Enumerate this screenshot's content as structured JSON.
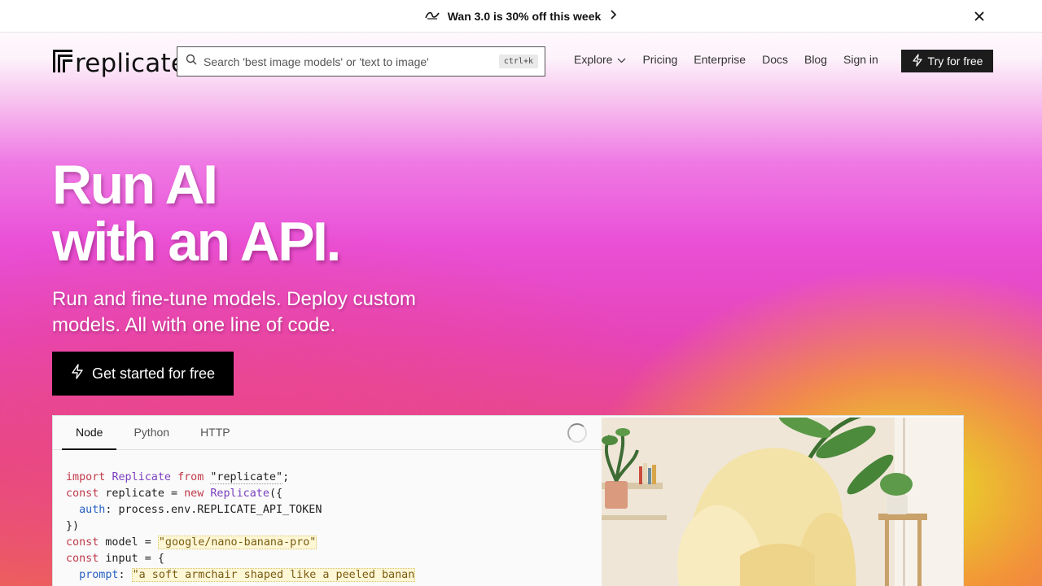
{
  "announcement": {
    "text": "Wan 3.0 is 30% off this week"
  },
  "nav": {
    "logo_text": "replicate",
    "search_placeholder": "Search 'best image models' or 'text to image'",
    "search_shortcut": "ctrl+k",
    "links": [
      "Explore",
      "Pricing",
      "Enterprise",
      "Docs",
      "Blog",
      "Sign in"
    ],
    "cta": "Try for free"
  },
  "hero": {
    "title_line1": "Run AI",
    "title_line2": "with an API.",
    "subtitle": "Run and fine-tune models. Deploy custom models. All with one line of code.",
    "cta": "Get started for free"
  },
  "code_panel": {
    "tabs": [
      "Node",
      "Python",
      "HTTP"
    ],
    "active_tab": "Node",
    "code": {
      "l1_kw1": "import",
      "l1_cls": "Replicate",
      "l1_kw2": "from",
      "l1_str": "\"replicate\"",
      "l1_end": ";",
      "l2_kw1": "const",
      "l2_var": " replicate = ",
      "l2_kw2": "new",
      "l2_cls": "Replicate",
      "l2_end": "({",
      "l3_prop": "auth",
      "l3_rest": ": process.env.REPLICATE_API_TOKEN",
      "l4": "})",
      "l5_kw": "const",
      "l5_var": " model = ",
      "l5_str": "\"google/nano-banana-pro\"",
      "l6_kw": "const",
      "l6_var": " input = {",
      "l7_prop": "prompt",
      "l7_colon": ": ",
      "l7_str": "\"a soft armchair shaped like a peeled banan"
    }
  }
}
